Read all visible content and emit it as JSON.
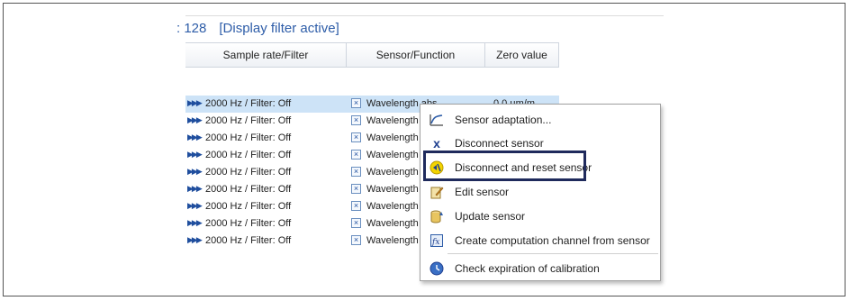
{
  "header": {
    "count": ": 128",
    "filter_status": "[Display filter active]"
  },
  "columns": [
    "Sample rate/Filter",
    "Sensor/Function",
    "Zero value"
  ],
  "rows": [
    {
      "rate": "2000 Hz / Filter: Off",
      "function": "Wavelength abs.",
      "zero": "0.0 µm/m",
      "selected": true
    },
    {
      "rate": "2000 Hz / Filter: Off",
      "function": "Wavelength"
    },
    {
      "rate": "2000 Hz / Filter: Off",
      "function": "Wavelength"
    },
    {
      "rate": "2000 Hz / Filter: Off",
      "function": "Wavelength"
    },
    {
      "rate": "2000 Hz / Filter: Off",
      "function": "Wavelength"
    },
    {
      "rate": "2000 Hz / Filter: Off",
      "function": "Wavelength"
    },
    {
      "rate": "2000 Hz / Filter: Off",
      "function": "Wavelength"
    },
    {
      "rate": "2000 Hz / Filter: Off",
      "function": "Wavelength"
    },
    {
      "rate": "2000 Hz / Filter: Off",
      "function": "Wavelength"
    }
  ],
  "context_menu": {
    "items": [
      {
        "label": "Sensor adaptation...",
        "icon": "sensor-adaptation-icon"
      },
      {
        "label": "Disconnect sensor",
        "icon": "disconnect-x-icon"
      },
      {
        "label": "Disconnect and reset sensor",
        "icon": "disconnect-reset-icon",
        "highlighted": true
      },
      {
        "label": "Edit sensor",
        "icon": "edit-sensor-icon"
      },
      {
        "label": "Update sensor",
        "icon": "update-sensor-icon"
      },
      {
        "label": "Create computation channel from sensor",
        "icon": "computation-channel-icon"
      },
      {
        "label": "Check expiration of calibration",
        "icon": "calibration-clock-icon"
      }
    ]
  },
  "colors": {
    "accent": "#2e5da8",
    "selection": "#cde3f7",
    "highlight_box": "#1f2a5c"
  }
}
